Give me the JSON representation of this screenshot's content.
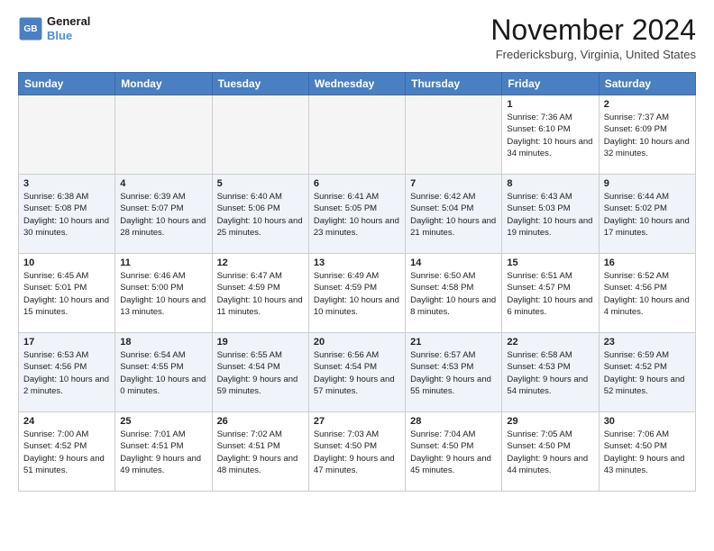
{
  "header": {
    "logo_line1": "General",
    "logo_line2": "Blue",
    "month": "November 2024",
    "location": "Fredericksburg, Virginia, United States"
  },
  "weekdays": [
    "Sunday",
    "Monday",
    "Tuesday",
    "Wednesday",
    "Thursday",
    "Friday",
    "Saturday"
  ],
  "weeks": [
    [
      {
        "day": "",
        "info": ""
      },
      {
        "day": "",
        "info": ""
      },
      {
        "day": "",
        "info": ""
      },
      {
        "day": "",
        "info": ""
      },
      {
        "day": "",
        "info": ""
      },
      {
        "day": "1",
        "info": "Sunrise: 7:36 AM\nSunset: 6:10 PM\nDaylight: 10 hours\nand 34 minutes."
      },
      {
        "day": "2",
        "info": "Sunrise: 7:37 AM\nSunset: 6:09 PM\nDaylight: 10 hours\nand 32 minutes."
      }
    ],
    [
      {
        "day": "3",
        "info": "Sunrise: 6:38 AM\nSunset: 5:08 PM\nDaylight: 10 hours\nand 30 minutes."
      },
      {
        "day": "4",
        "info": "Sunrise: 6:39 AM\nSunset: 5:07 PM\nDaylight: 10 hours\nand 28 minutes."
      },
      {
        "day": "5",
        "info": "Sunrise: 6:40 AM\nSunset: 5:06 PM\nDaylight: 10 hours\nand 25 minutes."
      },
      {
        "day": "6",
        "info": "Sunrise: 6:41 AM\nSunset: 5:05 PM\nDaylight: 10 hours\nand 23 minutes."
      },
      {
        "day": "7",
        "info": "Sunrise: 6:42 AM\nSunset: 5:04 PM\nDaylight: 10 hours\nand 21 minutes."
      },
      {
        "day": "8",
        "info": "Sunrise: 6:43 AM\nSunset: 5:03 PM\nDaylight: 10 hours\nand 19 minutes."
      },
      {
        "day": "9",
        "info": "Sunrise: 6:44 AM\nSunset: 5:02 PM\nDaylight: 10 hours\nand 17 minutes."
      }
    ],
    [
      {
        "day": "10",
        "info": "Sunrise: 6:45 AM\nSunset: 5:01 PM\nDaylight: 10 hours\nand 15 minutes."
      },
      {
        "day": "11",
        "info": "Sunrise: 6:46 AM\nSunset: 5:00 PM\nDaylight: 10 hours\nand 13 minutes."
      },
      {
        "day": "12",
        "info": "Sunrise: 6:47 AM\nSunset: 4:59 PM\nDaylight: 10 hours\nand 11 minutes."
      },
      {
        "day": "13",
        "info": "Sunrise: 6:49 AM\nSunset: 4:59 PM\nDaylight: 10 hours\nand 10 minutes."
      },
      {
        "day": "14",
        "info": "Sunrise: 6:50 AM\nSunset: 4:58 PM\nDaylight: 10 hours\nand 8 minutes."
      },
      {
        "day": "15",
        "info": "Sunrise: 6:51 AM\nSunset: 4:57 PM\nDaylight: 10 hours\nand 6 minutes."
      },
      {
        "day": "16",
        "info": "Sunrise: 6:52 AM\nSunset: 4:56 PM\nDaylight: 10 hours\nand 4 minutes."
      }
    ],
    [
      {
        "day": "17",
        "info": "Sunrise: 6:53 AM\nSunset: 4:56 PM\nDaylight: 10 hours\nand 2 minutes."
      },
      {
        "day": "18",
        "info": "Sunrise: 6:54 AM\nSunset: 4:55 PM\nDaylight: 10 hours\nand 0 minutes."
      },
      {
        "day": "19",
        "info": "Sunrise: 6:55 AM\nSunset: 4:54 PM\nDaylight: 9 hours\nand 59 minutes."
      },
      {
        "day": "20",
        "info": "Sunrise: 6:56 AM\nSunset: 4:54 PM\nDaylight: 9 hours\nand 57 minutes."
      },
      {
        "day": "21",
        "info": "Sunrise: 6:57 AM\nSunset: 4:53 PM\nDaylight: 9 hours\nand 55 minutes."
      },
      {
        "day": "22",
        "info": "Sunrise: 6:58 AM\nSunset: 4:53 PM\nDaylight: 9 hours\nand 54 minutes."
      },
      {
        "day": "23",
        "info": "Sunrise: 6:59 AM\nSunset: 4:52 PM\nDaylight: 9 hours\nand 52 minutes."
      }
    ],
    [
      {
        "day": "24",
        "info": "Sunrise: 7:00 AM\nSunset: 4:52 PM\nDaylight: 9 hours\nand 51 minutes."
      },
      {
        "day": "25",
        "info": "Sunrise: 7:01 AM\nSunset: 4:51 PM\nDaylight: 9 hours\nand 49 minutes."
      },
      {
        "day": "26",
        "info": "Sunrise: 7:02 AM\nSunset: 4:51 PM\nDaylight: 9 hours\nand 48 minutes."
      },
      {
        "day": "27",
        "info": "Sunrise: 7:03 AM\nSunset: 4:50 PM\nDaylight: 9 hours\nand 47 minutes."
      },
      {
        "day": "28",
        "info": "Sunrise: 7:04 AM\nSunset: 4:50 PM\nDaylight: 9 hours\nand 45 minutes."
      },
      {
        "day": "29",
        "info": "Sunrise: 7:05 AM\nSunset: 4:50 PM\nDaylight: 9 hours\nand 44 minutes."
      },
      {
        "day": "30",
        "info": "Sunrise: 7:06 AM\nSunset: 4:50 PM\nDaylight: 9 hours\nand 43 minutes."
      }
    ]
  ]
}
